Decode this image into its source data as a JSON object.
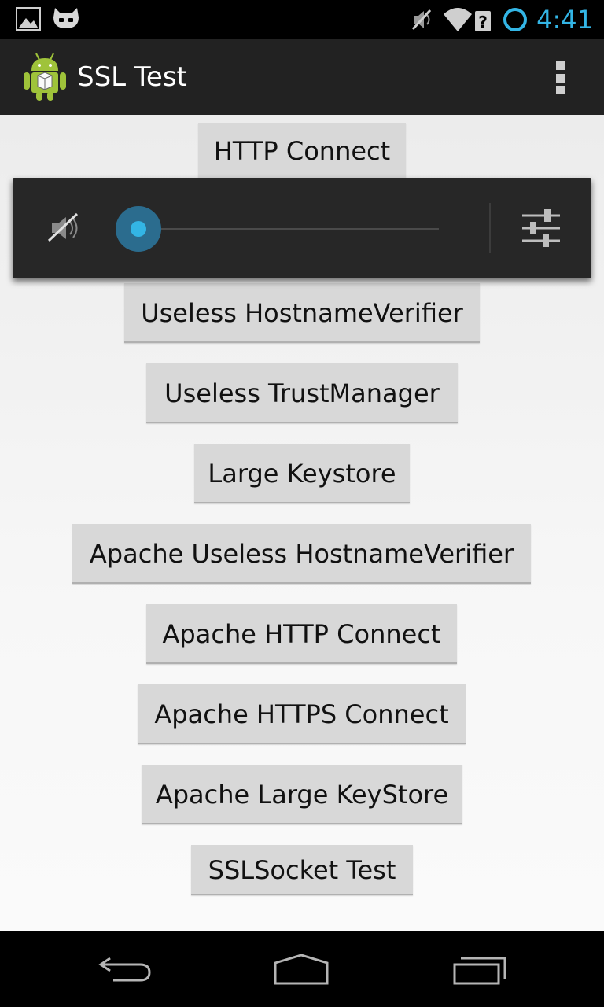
{
  "status_bar": {
    "time": "4:41",
    "left_icons": [
      "gallery-notification-icon",
      "cyanogen-notification-icon"
    ],
    "right_icons": [
      "mute-icon",
      "wifi-unknown-icon",
      "battery-ring-icon"
    ]
  },
  "action_bar": {
    "title": "SSL Test",
    "app_icon": "android-robot-icon",
    "overflow_icon": "overflow-menu-icon"
  },
  "buttons": [
    {
      "label": "HTTP Connect"
    },
    {
      "label": "Useless HostnameVerifier"
    },
    {
      "label": "Useless TrustManager"
    },
    {
      "label": "Large Keystore"
    },
    {
      "label": "Apache Useless HostnameVerifier"
    },
    {
      "label": "Apache HTTP Connect"
    },
    {
      "label": "Apache HTTPS Connect"
    },
    {
      "label": "Apache Large KeyStore"
    },
    {
      "label": "SSLSocket Test"
    }
  ],
  "volume_panel": {
    "muted": true,
    "level": 0,
    "accent_color": "#33b5e5"
  },
  "nav_bar": {
    "buttons": [
      "back-icon",
      "home-icon",
      "recents-icon"
    ]
  }
}
